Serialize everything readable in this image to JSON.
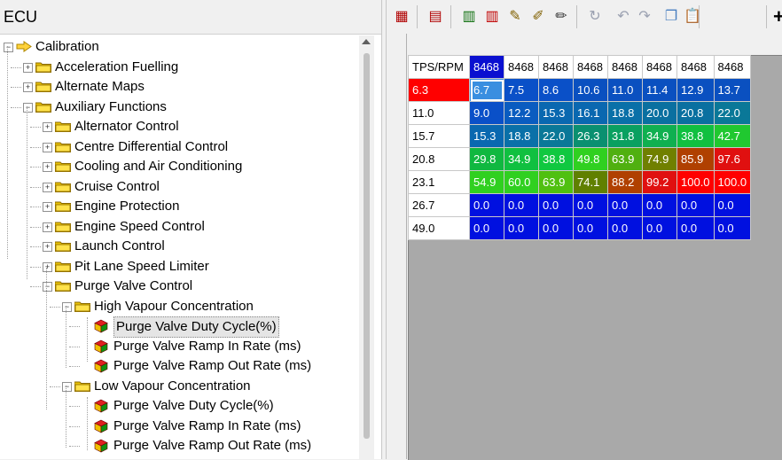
{
  "left_panel": {
    "title": "ECU",
    "tree": [
      {
        "label": "Calibration",
        "level": 0,
        "expander": "-",
        "icon": "arrow"
      },
      {
        "label": "Acceleration Fuelling",
        "level": 1,
        "expander": "+",
        "icon": "folder"
      },
      {
        "label": "Alternate Maps",
        "level": 1,
        "expander": "+",
        "icon": "folder"
      },
      {
        "label": "Auxiliary Functions",
        "level": 1,
        "expander": "-",
        "icon": "folder"
      },
      {
        "label": "Alternator Control",
        "level": 2,
        "expander": "+",
        "icon": "folder"
      },
      {
        "label": "Centre Differential Control",
        "level": 2,
        "expander": "+",
        "icon": "folder"
      },
      {
        "label": "Cooling and Air Conditioning",
        "level": 2,
        "expander": "+",
        "icon": "folder"
      },
      {
        "label": "Cruise Control",
        "level": 2,
        "expander": "+",
        "icon": "folder"
      },
      {
        "label": "Engine Protection",
        "level": 2,
        "expander": "+",
        "icon": "folder"
      },
      {
        "label": "Engine Speed Control",
        "level": 2,
        "expander": "+",
        "icon": "folder"
      },
      {
        "label": "Launch Control",
        "level": 2,
        "expander": "+",
        "icon": "folder"
      },
      {
        "label": "Pit Lane Speed Limiter",
        "level": 2,
        "expander": "+",
        "icon": "folder"
      },
      {
        "label": "Purge Valve Control",
        "level": 2,
        "expander": "-",
        "icon": "folder"
      },
      {
        "label": "High Vapour Concentration",
        "level": 3,
        "expander": "-",
        "icon": "folder"
      },
      {
        "label": "Purge Valve Duty Cycle(%)",
        "level": 4,
        "expander": "",
        "icon": "cube",
        "selected": true
      },
      {
        "label": "Purge Valve Ramp In Rate (ms)",
        "level": 4,
        "expander": "",
        "icon": "cube"
      },
      {
        "label": "Purge Valve Ramp Out Rate (ms)",
        "level": 4,
        "expander": "",
        "icon": "cube"
      },
      {
        "label": "Low Vapour Concentration",
        "level": 3,
        "expander": "-",
        "icon": "folder"
      },
      {
        "label": "Purge Valve Duty Cycle(%)",
        "level": 4,
        "expander": "",
        "icon": "cube"
      },
      {
        "label": "Purge Valve Ramp In Rate (ms)",
        "level": 4,
        "expander": "",
        "icon": "cube"
      },
      {
        "label": "Purge Valve Ramp Out Rate (ms)",
        "level": 4,
        "expander": "",
        "icon": "cube"
      }
    ]
  },
  "toolbar": {
    "buttons": [
      {
        "name": "insert-row-icon",
        "glyph": "▦",
        "color": "#b00000"
      },
      {
        "name": "delete-row-icon",
        "glyph": "▤",
        "color": "#b00000"
      },
      {
        "name": "insert-column-icon",
        "glyph": "▥",
        "color": "#107010"
      },
      {
        "name": "delete-column-icon",
        "glyph": "▥",
        "color": "#c00000"
      },
      {
        "name": "edit-pencil-icon",
        "glyph": "✎",
        "color": "#806000"
      },
      {
        "name": "edit-check-icon",
        "glyph": "✐",
        "color": "#806000"
      },
      {
        "name": "eraser-icon",
        "glyph": "✏",
        "color": "#303030"
      },
      {
        "name": "refresh-icon",
        "glyph": "↻",
        "color": "#9aa0b0"
      },
      {
        "name": "undo-icon",
        "glyph": "↶",
        "color": "#9aa0b0"
      },
      {
        "name": "redo-icon",
        "glyph": "↷",
        "color": "#9aa0b0"
      },
      {
        "name": "copy-icon",
        "glyph": "❐",
        "color": "#4a80c0"
      },
      {
        "name": "paste-icon",
        "glyph": "📋",
        "color": "#4a80c0"
      },
      {
        "name": "add-icon",
        "glyph": "+",
        "color": "#000000"
      }
    ]
  },
  "table": {
    "corner": "TPS/RPM",
    "columns": [
      "8468",
      "8468",
      "8468",
      "8468",
      "8468",
      "8468",
      "8468",
      "8468"
    ],
    "rows": [
      {
        "header": "6.3",
        "values": [
          "6.7",
          "7.5",
          "8.6",
          "10.6",
          "11.0",
          "11.4",
          "12.9",
          "13.7"
        ]
      },
      {
        "header": "11.0",
        "values": [
          "9.0",
          "12.2",
          "15.3",
          "16.1",
          "18.8",
          "20.0",
          "20.8",
          "22.0"
        ]
      },
      {
        "header": "15.7",
        "values": [
          "15.3",
          "18.8",
          "22.0",
          "26.3",
          "31.8",
          "34.9",
          "38.8",
          "42.7"
        ]
      },
      {
        "header": "20.8",
        "values": [
          "29.8",
          "34.9",
          "38.8",
          "49.8",
          "63.9",
          "74.9",
          "85.9",
          "97.6"
        ]
      },
      {
        "header": "23.1",
        "values": [
          "54.9",
          "60.0",
          "63.9",
          "74.1",
          "88.2",
          "99.2",
          "100.0",
          "100.0"
        ]
      },
      {
        "header": "26.7",
        "values": [
          "0.0",
          "0.0",
          "0.0",
          "0.0",
          "0.0",
          "0.0",
          "0.0",
          "0.0"
        ]
      },
      {
        "header": "49.0",
        "values": [
          "0.0",
          "0.0",
          "0.0",
          "0.0",
          "0.0",
          "0.0",
          "0.0",
          "0.0"
        ]
      }
    ],
    "cell_colors": [
      [
        "#0a5fd8",
        "#0a50c8",
        "#0a50c8",
        "#0a50c0",
        "#0a50c0",
        "#0a50c0",
        "#0a50c0",
        "#0a50c0"
      ],
      [
        "#0a50c8",
        "#0a5cc0",
        "#0a68b0",
        "#0a68b0",
        "#0a70a8",
        "#0a70a0",
        "#0a70a0",
        "#0a7898"
      ],
      [
        "#0a68b0",
        "#0a70a8",
        "#0a7898",
        "#0a9070",
        "#0aa060",
        "#10b050",
        "#10c040",
        "#20c830"
      ],
      [
        "#10b840",
        "#10c040",
        "#10c840",
        "#30d020",
        "#50b010",
        "#708000",
        "#b04000",
        "#e01010"
      ],
      [
        "#30d020",
        "#30d020",
        "#50c010",
        "#608000",
        "#b04000",
        "#e01010",
        "#ff0000",
        "#ff0000"
      ],
      [
        "#0010e0",
        "#0010e0",
        "#0010e0",
        "#0010e0",
        "#0010e0",
        "#0010e0",
        "#0010e0",
        "#0010e0"
      ],
      [
        "#0010e0",
        "#0010e0",
        "#0010e0",
        "#0010e0",
        "#0010e0",
        "#0010e0",
        "#0010e0",
        "#0010e0"
      ]
    ],
    "row_header_colors": [
      "#ff0000",
      "#ffffff",
      "#ffffff",
      "#ffffff",
      "#ffffff",
      "#ffffff",
      "#ffffff"
    ],
    "highlighted_column_header_color": "#0a10d0"
  }
}
